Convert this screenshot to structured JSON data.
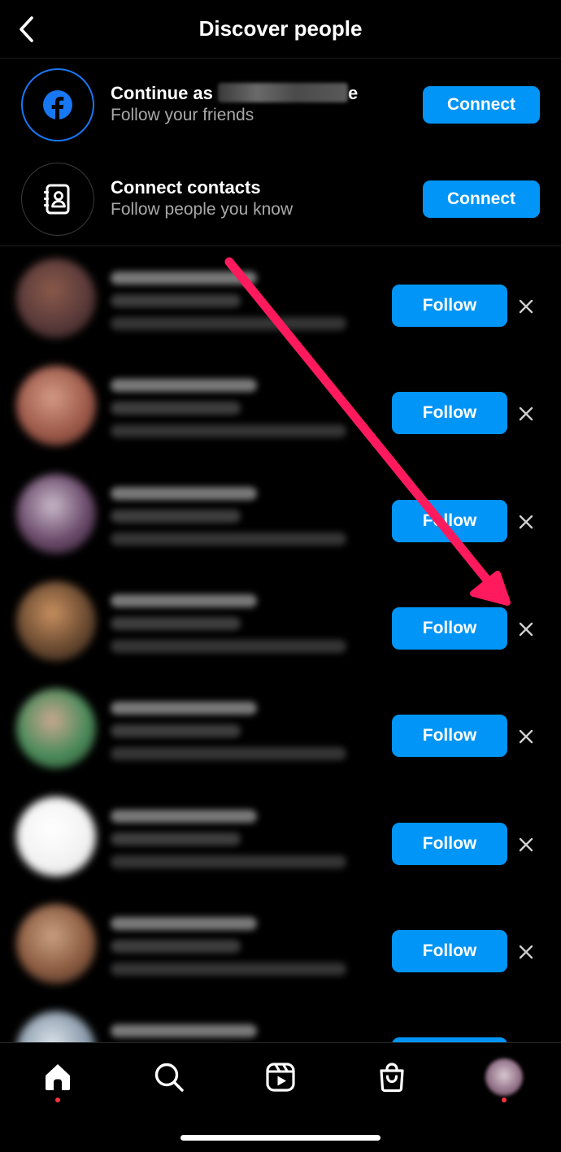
{
  "header": {
    "title": "Discover people"
  },
  "connect": [
    {
      "title_prefix": "Continue as",
      "title_suffix": "e",
      "subtitle": "Follow your friends",
      "button": "Connect",
      "icon": "facebook-icon"
    },
    {
      "title": "Connect contacts",
      "subtitle": "Follow people you know",
      "button": "Connect",
      "icon": "contacts-icon"
    }
  ],
  "people": {
    "follow_label": "Follow",
    "dismiss_icon": "close-icon",
    "rows": [
      {
        "avatar_colors": [
          "#8a5a4a",
          "#5a3a3a",
          "#2a1a1a"
        ]
      },
      {
        "avatar_colors": [
          "#d39a85",
          "#9e5a4a",
          "#5a2f2a"
        ]
      },
      {
        "avatar_colors": [
          "#c9b9c9",
          "#6a4a6a",
          "#2a1a2a"
        ]
      },
      {
        "avatar_colors": [
          "#c89060",
          "#6a4a30",
          "#2a2018"
        ]
      },
      {
        "avatar_colors": [
          "#c9a890",
          "#4a8a5a",
          "#2a4a2a"
        ]
      },
      {
        "avatar_colors": [
          "#ffffff",
          "#f2f2f2",
          "#d8d8d8"
        ]
      },
      {
        "avatar_colors": [
          "#c9a080",
          "#8a5a40",
          "#3a2a20"
        ]
      },
      {
        "avatar_colors": [
          "#d9e2ea",
          "#8a9aaa",
          "#3a4a5a"
        ]
      }
    ]
  },
  "tabbar": {
    "icons": [
      "home-icon",
      "search-icon",
      "reels-icon",
      "shop-icon",
      "profile-avatar"
    ]
  },
  "colors": {
    "accent": "#0095f6",
    "arrow": "#ff1a5e",
    "notification": "#ff3040",
    "facebook": "#1877f2"
  }
}
